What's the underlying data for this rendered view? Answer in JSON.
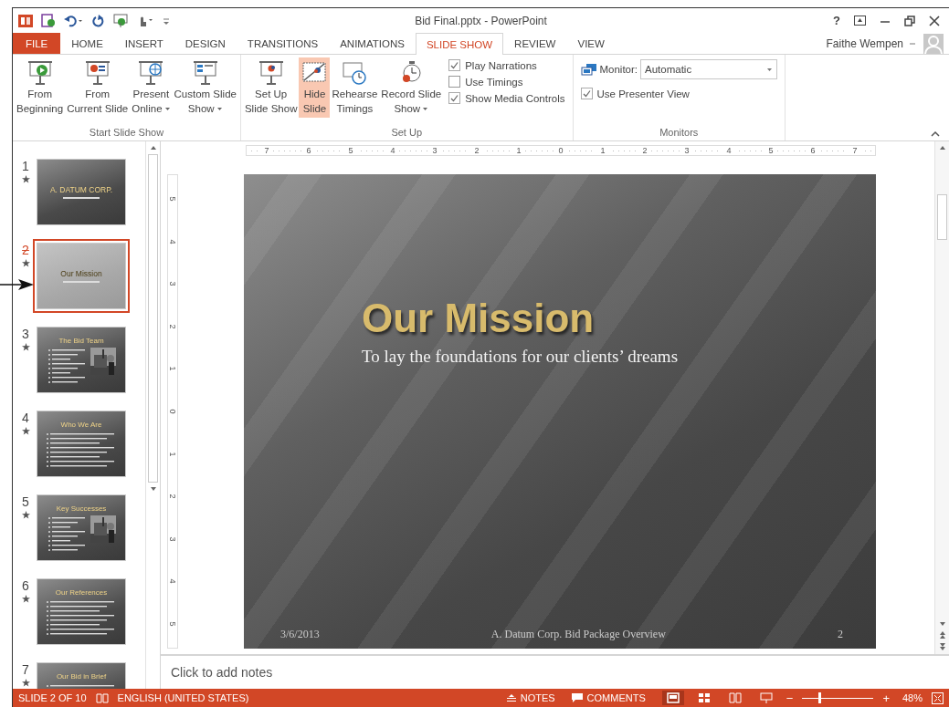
{
  "window": {
    "title": "Bid Final.pptx - PowerPoint",
    "help": "?"
  },
  "tabs": [
    {
      "label": "FILE",
      "kind": "file",
      "selected": false
    },
    {
      "label": "HOME",
      "kind": "tab",
      "selected": false
    },
    {
      "label": "INSERT",
      "kind": "tab",
      "selected": false
    },
    {
      "label": "DESIGN",
      "kind": "tab",
      "selected": false
    },
    {
      "label": "TRANSITIONS",
      "kind": "tab",
      "selected": false
    },
    {
      "label": "ANIMATIONS",
      "kind": "tab",
      "selected": false
    },
    {
      "label": "SLIDE SHOW",
      "kind": "tab",
      "selected": true
    },
    {
      "label": "REVIEW",
      "kind": "tab",
      "selected": false
    },
    {
      "label": "VIEW",
      "kind": "tab",
      "selected": false
    }
  ],
  "account": {
    "name": "Faithe Wempen"
  },
  "ribbon": {
    "groups": [
      {
        "label": "Start Slide Show",
        "buttons": [
          {
            "kind": "play",
            "lines": [
              "From",
              "Beginning"
            ],
            "menu": false,
            "selected": false
          },
          {
            "kind": "current",
            "lines": [
              "From",
              "Current Slide"
            ],
            "menu": false,
            "selected": false
          },
          {
            "kind": "globe",
            "lines": [
              "Present",
              "Online"
            ],
            "menu": true,
            "selected": false
          },
          {
            "kind": "custom",
            "lines": [
              "Custom Slide",
              "Show"
            ],
            "menu": true,
            "selected": false
          }
        ]
      },
      {
        "label": "Set Up",
        "buttons": [
          {
            "kind": "setup",
            "lines": [
              "Set Up",
              "Slide Show"
            ],
            "menu": false,
            "selected": false
          },
          {
            "kind": "hide",
            "lines": [
              "Hide",
              "Slide"
            ],
            "menu": false,
            "selected": true
          },
          {
            "kind": "timer",
            "lines": [
              "Rehearse",
              "Timings"
            ],
            "menu": false,
            "selected": false
          },
          {
            "kind": "record",
            "lines": [
              "Record Slide",
              "Show"
            ],
            "menu": true,
            "selected": false
          }
        ],
        "checkboxes": [
          {
            "label": "Play Narrations",
            "checked": true
          },
          {
            "label": "Use Timings",
            "checked": false
          },
          {
            "label": "Show Media Controls",
            "checked": true
          }
        ]
      },
      {
        "label": "Monitors",
        "monitor": {
          "label": "Monitor:",
          "value": "Automatic"
        },
        "checkboxes": [
          {
            "label": "Use Presenter View",
            "checked": true
          }
        ]
      }
    ]
  },
  "slides": [
    {
      "number": "1",
      "title": "A. DATUM CORP.",
      "kind": "title",
      "hidden": false,
      "selected": false
    },
    {
      "number": "2",
      "title": "Our Mission",
      "kind": "title",
      "hidden": true,
      "selected": true
    },
    {
      "number": "3",
      "title": "The Bid Team",
      "kind": "bullets_photo",
      "hidden": false,
      "selected": false
    },
    {
      "number": "4",
      "title": "Who We Are",
      "kind": "bullets",
      "hidden": false,
      "selected": false
    },
    {
      "number": "5",
      "title": "Key Successes",
      "kind": "bullets_photo",
      "hidden": false,
      "selected": false
    },
    {
      "number": "6",
      "title": "Our References",
      "kind": "bullets",
      "hidden": false,
      "selected": false
    },
    {
      "number": "7",
      "title": "Our Bid in Brief",
      "kind": "bullets",
      "hidden": false,
      "selected": false
    }
  ],
  "rulers": {
    "horizontal": [
      "7",
      "6",
      "5",
      "4",
      "3",
      "2",
      "1",
      "0",
      "1",
      "2",
      "3",
      "4",
      "5",
      "6",
      "7"
    ],
    "vertical": [
      "5",
      "4",
      "3",
      "2",
      "1",
      "0",
      "1",
      "2",
      "3",
      "4",
      "5"
    ]
  },
  "slide": {
    "title": "Our Mission",
    "subtitle": "To lay the foundations for our clients’ dreams",
    "date": "3/6/2013",
    "footer": "A. Datum Corp. Bid Package Overview",
    "page": "2"
  },
  "notes": {
    "placeholder": "Click to add notes"
  },
  "status_bar": {
    "slide_info": "SLIDE 2 OF 10",
    "language": "ENGLISH (UNITED STATES)",
    "notes": "NOTES",
    "comments": "COMMENTS",
    "views": [
      {
        "kind": "normal",
        "selected": true
      },
      {
        "kind": "sorter",
        "selected": false
      },
      {
        "kind": "reading",
        "selected": false
      },
      {
        "kind": "slideshow",
        "selected": false
      }
    ],
    "zoom": {
      "minus": "−",
      "plus": "+",
      "level": 0.24,
      "reading": "48%"
    }
  }
}
